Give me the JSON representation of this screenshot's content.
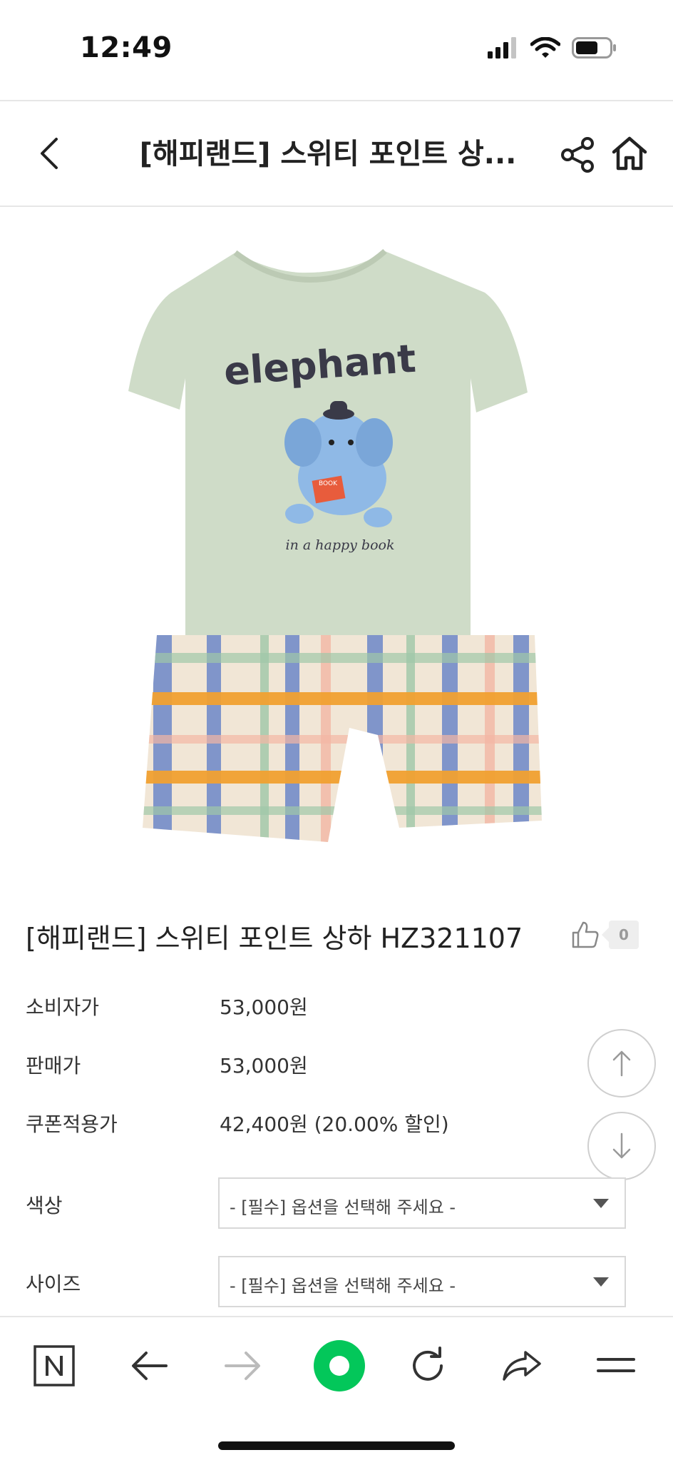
{
  "status_bar": {
    "time": "12:49"
  },
  "header": {
    "title": "[해피랜드] 스위티 포인트 상..."
  },
  "product": {
    "name": "[해피랜드] 스위티 포인트 상하 HZ321107",
    "like_count": "0",
    "image_print_text": "elephant",
    "image_subtext": "in a happy book",
    "image_book_text": "BOOK"
  },
  "prices": [
    {
      "label": "소비자가",
      "value": "53,000원"
    },
    {
      "label": "판매가",
      "value": "53,000원"
    },
    {
      "label": "쿠폰적용가",
      "value": "42,400원 (20.00% 할인)"
    }
  ],
  "options": [
    {
      "label": "색상",
      "placeholder": "- [필수] 옵션을 선택해 주세요 -"
    },
    {
      "label": "사이즈",
      "placeholder": "- [필수] 옵션을 선택해 주세요 -"
    }
  ],
  "colors": {
    "naver_green": "#03c75a",
    "shirt": "#cfdcc8",
    "elephant": "#8fb9e6",
    "plaid_orange": "#f0a030",
    "plaid_blue": "#6c86c8"
  },
  "icons": {
    "back": "chevron-left-icon",
    "share": "share-icon",
    "home": "home-icon",
    "like": "thumbs-up-icon",
    "scroll_up": "arrow-up-icon",
    "scroll_down": "arrow-down-icon",
    "naver": "naver-n-icon",
    "nav_back": "arrow-left-icon",
    "nav_forward": "arrow-right-icon",
    "green_dot": "green-dot-icon",
    "reload": "reload-icon",
    "share_out": "share-arrow-icon",
    "menu": "menu-icon"
  }
}
